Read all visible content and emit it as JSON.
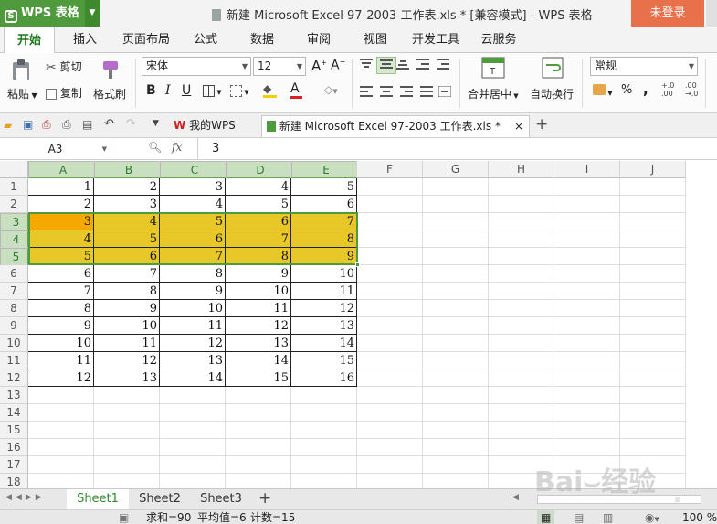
{
  "app": {
    "name": "WPS 表格",
    "login": "未登录"
  },
  "window": {
    "title": "新建 Microsoft Excel 97-2003 工作表.xls * [兼容模式] - WPS 表格"
  },
  "ribbon_tabs": [
    "开始",
    "插入",
    "页面布局",
    "公式",
    "数据",
    "审阅",
    "视图",
    "开发工具",
    "云服务"
  ],
  "ribbon": {
    "paste": "粘贴",
    "cut": "剪切",
    "copy": "复制",
    "format_painter": "格式刷",
    "font_name": "宋体",
    "font_size": "12",
    "merge_center": "合并居中",
    "wrap_text": "自动换行",
    "number_format": "常规",
    "percent": "%",
    "comma": ","
  },
  "doc_tabs": [
    {
      "label": "我的WPS"
    },
    {
      "label": "新建 Microsoft Excel 97-2003 工作表.xls *",
      "close": "×"
    }
  ],
  "add_tab": "+",
  "formula_bar": {
    "cell_ref": "A3",
    "fx": "fx",
    "value": "3"
  },
  "columns": [
    "A",
    "B",
    "C",
    "D",
    "E",
    "F",
    "G",
    "H",
    "I",
    "J"
  ],
  "rows": [
    "1",
    "2",
    "3",
    "4",
    "5",
    "6",
    "7",
    "8",
    "9",
    "10",
    "11",
    "12",
    "13",
    "14",
    "15",
    "16",
    "17",
    "18"
  ],
  "cells": [
    [
      "1",
      "2",
      "3",
      "4",
      "5"
    ],
    [
      "2",
      "3",
      "4",
      "5",
      "6"
    ],
    [
      "3",
      "4",
      "5",
      "6",
      "7"
    ],
    [
      "4",
      "5",
      "6",
      "7",
      "8"
    ],
    [
      "5",
      "6",
      "7",
      "8",
      "9"
    ],
    [
      "6",
      "7",
      "8",
      "9",
      "10"
    ],
    [
      "7",
      "8",
      "9",
      "10",
      "11"
    ],
    [
      "8",
      "9",
      "10",
      "11",
      "12"
    ],
    [
      "9",
      "10",
      "11",
      "12",
      "13"
    ],
    [
      "10",
      "11",
      "12",
      "13",
      "14"
    ],
    [
      "11",
      "12",
      "13",
      "14",
      "15"
    ],
    [
      "12",
      "13",
      "14",
      "15",
      "16"
    ]
  ],
  "highlight_color": "#e8c828",
  "active_cell_color": "#f5a800",
  "sheets": [
    "Sheet1",
    "Sheet2",
    "Sheet3"
  ],
  "add_sheet": "+",
  "status": {
    "sum": "求和=90",
    "avg": "平均值=6",
    "count": "计数=15",
    "zoom": "100 %"
  }
}
